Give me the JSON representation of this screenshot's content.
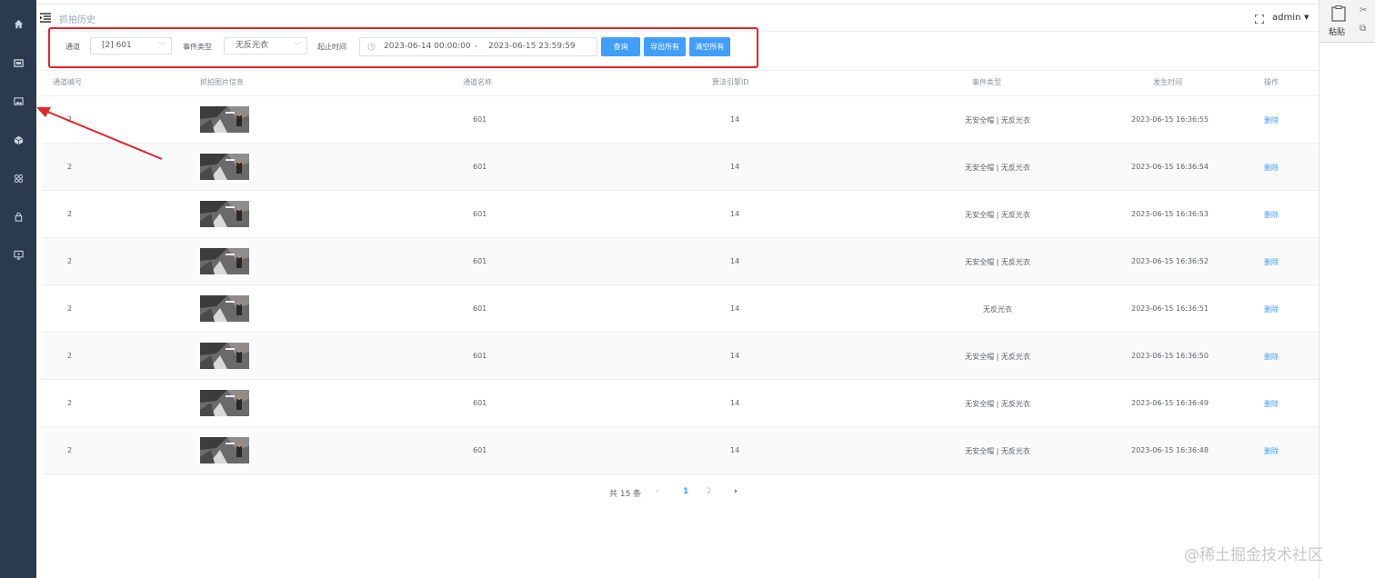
{
  "header": {
    "page_title": "抓拍历史",
    "user": "admin"
  },
  "filters": {
    "channel_label": "通道",
    "channel_value": "[2] 601",
    "event_label": "事件类型",
    "event_value": "无反光衣",
    "time_label": "起止时间",
    "start_time": "2023-06-14 00:00:00",
    "time_sep": "-",
    "end_time": "2023-06-15 23:59:59",
    "query_button": "查询",
    "export_button": "导出所有",
    "clear_button": "清空所有"
  },
  "table": {
    "headers": {
      "channel_no": "通道编号",
      "image_info": "抓拍图片信息",
      "channel_name": "通道名称",
      "engine_id": "算法引擎ID",
      "event_type": "事件类型",
      "time": "发生时间",
      "action": "操作"
    },
    "rows": [
      {
        "channel_no": "2",
        "channel_name": "601",
        "engine_id": "14",
        "event_type": "无安全帽 | 无反光衣",
        "time": "2023-06-15 16:36:55",
        "action": "删除"
      },
      {
        "channel_no": "2",
        "channel_name": "601",
        "engine_id": "14",
        "event_type": "无安全帽 | 无反光衣",
        "time": "2023-06-15 16:36:54",
        "action": "删除"
      },
      {
        "channel_no": "2",
        "channel_name": "601",
        "engine_id": "14",
        "event_type": "无安全帽 | 无反光衣",
        "time": "2023-06-15 16:36:53",
        "action": "删除"
      },
      {
        "channel_no": "2",
        "channel_name": "601",
        "engine_id": "14",
        "event_type": "无安全帽 | 无反光衣",
        "time": "2023-06-15 16:36:52",
        "action": "删除"
      },
      {
        "channel_no": "2",
        "channel_name": "601",
        "engine_id": "14",
        "event_type": "无反光衣",
        "time": "2023-06-15 16:36:51",
        "action": "删除"
      },
      {
        "channel_no": "2",
        "channel_name": "601",
        "engine_id": "14",
        "event_type": "无安全帽 | 无反光衣",
        "time": "2023-06-15 16:36:50",
        "action": "删除"
      },
      {
        "channel_no": "2",
        "channel_name": "601",
        "engine_id": "14",
        "event_type": "无安全帽 | 无反光衣",
        "time": "2023-06-15 16:36:49",
        "action": "删除"
      },
      {
        "channel_no": "2",
        "channel_name": "601",
        "engine_id": "14",
        "event_type": "无安全帽 | 无反光衣",
        "time": "2023-06-15 16:36:48",
        "action": "删除"
      }
    ]
  },
  "pagination": {
    "total": "共 15 条",
    "prev": "‹",
    "pages": [
      "1",
      "2"
    ],
    "next": "›"
  },
  "watermark": "@稀土掘金技术社区",
  "right_panel": {
    "paste_label": "粘贴"
  },
  "colors": {
    "sidebar": "#2b3a4f",
    "primary": "#409eff",
    "highlight": "#e8232a"
  }
}
